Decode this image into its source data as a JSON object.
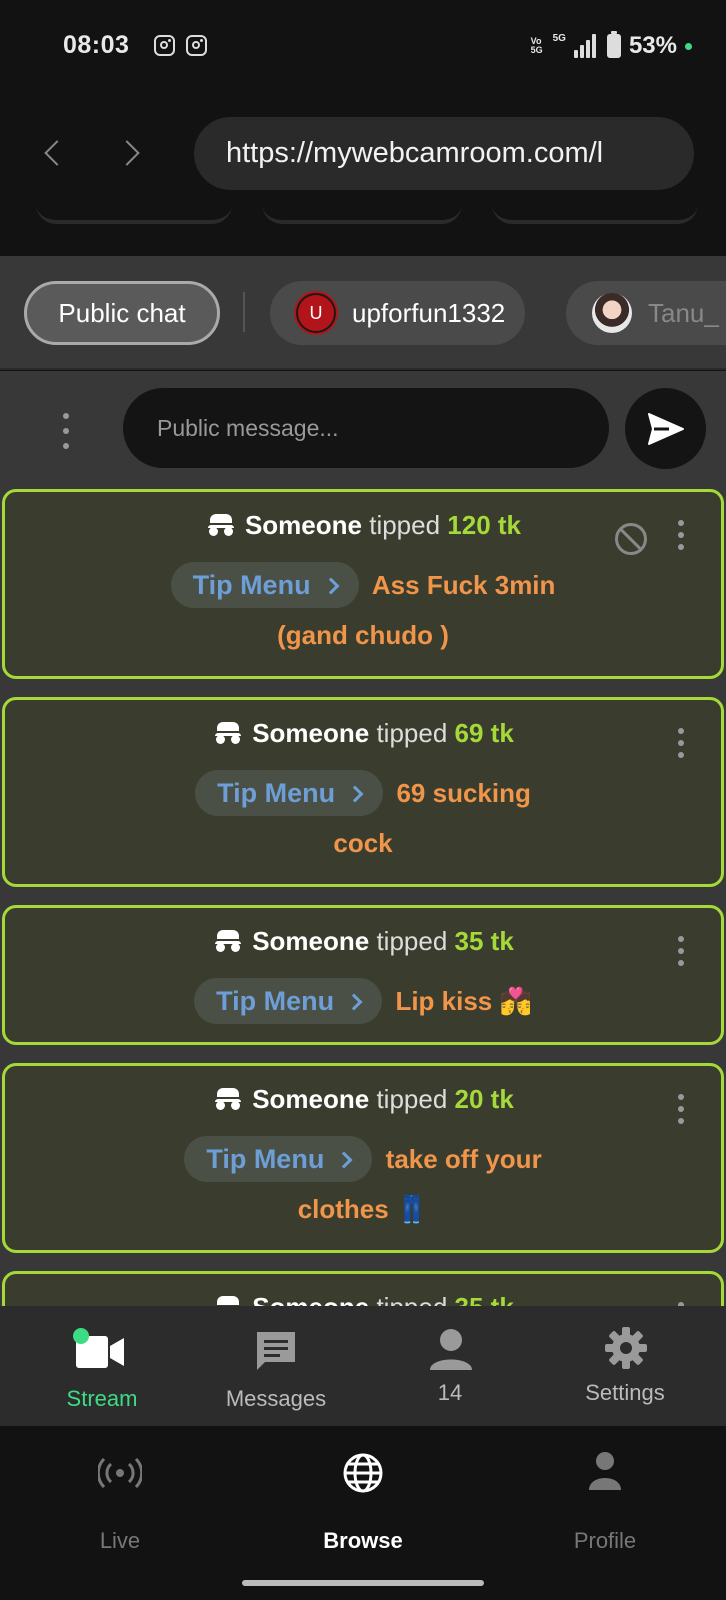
{
  "status_bar": {
    "time": "08:03",
    "volte": "Vo 5G",
    "network": "5G",
    "battery": "53%"
  },
  "browser": {
    "url": "https://mywebcamroom.com/l"
  },
  "chat_tabs": [
    {
      "label": "Public chat",
      "active": true
    },
    {
      "label": "upforfun1332",
      "avatar_letter": "U"
    },
    {
      "label": "Tanu_"
    }
  ],
  "message_input": {
    "placeholder": "Public message..."
  },
  "tips": [
    {
      "who": "Someone",
      "verb": "tipped",
      "amount": "120 tk",
      "pill": "Tip Menu",
      "text_line1": "Ass Fuck 3min",
      "text_line2": "(gand chudo )"
    },
    {
      "who": "Someone",
      "verb": "tipped",
      "amount": "69 tk",
      "pill": "Tip Menu",
      "text_line1": "69 sucking",
      "text_line2": "cock"
    },
    {
      "who": "Someone",
      "verb": "tipped",
      "amount": "35 tk",
      "pill": "Tip Menu",
      "text_line1": "Lip kiss 💏",
      "text_line2": ""
    },
    {
      "who": "Someone",
      "verb": "tipped",
      "amount": "20 tk",
      "pill": "Tip Menu",
      "text_line1": "take off your",
      "text_line2": "clothes 👖"
    },
    {
      "who": "Someone",
      "verb": "tipped",
      "amount": "35 tk"
    }
  ],
  "app_tabs": [
    {
      "label": "Stream",
      "icon": "video-camera-icon",
      "active": true
    },
    {
      "label": "Messages",
      "icon": "message-icon"
    },
    {
      "label": "14",
      "icon": "person-icon"
    },
    {
      "label": "Settings",
      "icon": "gear-icon"
    }
  ],
  "browser_nav": [
    {
      "label": "Live",
      "icon": "broadcast-icon"
    },
    {
      "label": "Browse",
      "icon": "globe-icon",
      "active": true
    },
    {
      "label": "Profile",
      "icon": "profile-icon"
    }
  ],
  "colors": {
    "accent_green": "#a5d93a",
    "stream_green": "#3ddc84",
    "tip_orange": "#f0954a",
    "pill_blue": "#6d9fd6"
  }
}
